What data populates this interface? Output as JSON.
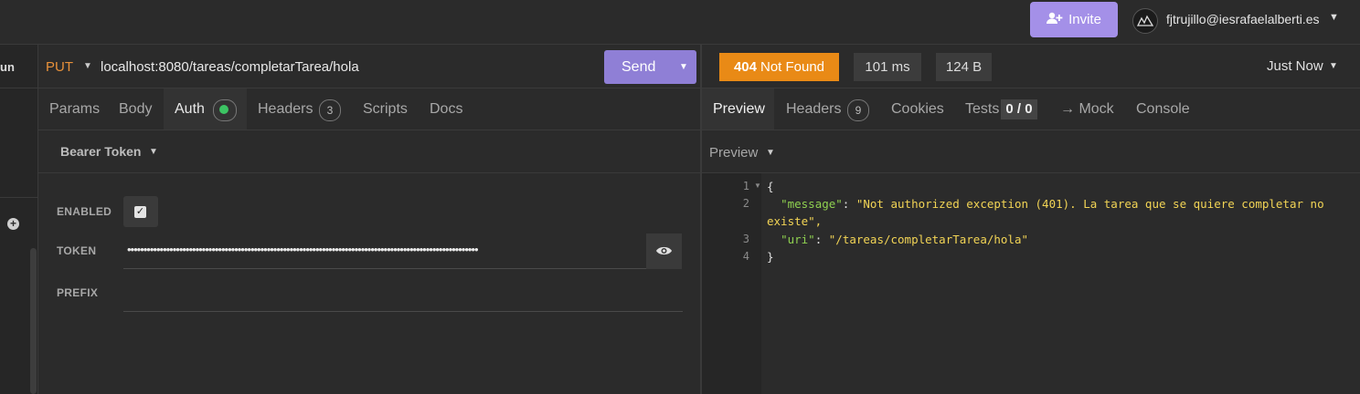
{
  "header": {
    "invite_label": "Invite",
    "user_email": "fjtrujillo@iesrafaelalberti.es"
  },
  "sidebar": {
    "run_label": "un"
  },
  "request": {
    "method": "PUT",
    "url": "localhost:8080/tareas/completarTarea/hola",
    "send_label": "Send",
    "tabs": [
      {
        "label": "Params"
      },
      {
        "label": "Body"
      },
      {
        "label": "Auth",
        "active": true
      },
      {
        "label": "Headers",
        "badge": "3"
      },
      {
        "label": "Scripts"
      },
      {
        "label": "Docs"
      }
    ],
    "auth": {
      "type": "Bearer Token",
      "enabled_label": "ENABLED",
      "enabled": true,
      "token_label": "TOKEN",
      "token_value": "••••••••••••••••••••••••••••••••••••••••••••••••••••••••••••••••••••••••••••••••••••••••••••••••••••••••••••",
      "prefix_label": "PREFIX",
      "prefix_value": ""
    }
  },
  "response": {
    "status_code": "404",
    "status_text": "Not Found",
    "status_color": "#e98a16",
    "time": "101 ms",
    "size": "124 B",
    "history": "Just Now",
    "tabs": [
      {
        "label": "Preview",
        "active": true
      },
      {
        "label": "Headers",
        "badge": "9"
      },
      {
        "label": "Cookies"
      },
      {
        "label": "Tests",
        "badge": "0 / 0"
      },
      {
        "label": "→ Mock"
      },
      {
        "label": "Console"
      }
    ],
    "preview_mode": "Preview",
    "body_lines": [
      {
        "n": "1",
        "text": "{"
      },
      {
        "n": "2",
        "key": "\"message\"",
        "value": "\"Not authorized exception (401). La tarea que se quiere completar no",
        "cont": "existe\","
      },
      {
        "n": "3",
        "key": "\"uri\"",
        "value": "\"/tareas/completarTarea/hola\""
      },
      {
        "n": "4",
        "text": "}"
      }
    ]
  }
}
